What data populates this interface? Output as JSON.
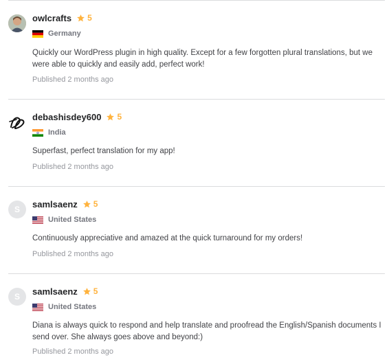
{
  "colors": {
    "star": "#ffb33e",
    "divider": "#dadbdd",
    "meta": "#95979d"
  },
  "reviews": [
    {
      "username": "owlcrafts",
      "rating": "5",
      "country": "Germany",
      "flag_icon": "germany-flag-icon",
      "avatar": "user-photo",
      "description": "Quickly our WordPress plugin in high quality. Except for a few forgotten plural translations, but we were able to quickly and easily add, perfect work!",
      "published": "Published 2 months ago"
    },
    {
      "username": "debashisdey600",
      "rating": "5",
      "country": "India",
      "flag_icon": "india-flag-icon",
      "avatar": "dd-signature-logo",
      "description": "Superfast, perfect translation for my app!",
      "published": "Published 2 months ago"
    },
    {
      "username": "samlsaenz",
      "rating": "5",
      "country": "United States",
      "flag_icon": "us-flag-icon",
      "avatar_initial": "S",
      "description": "Continuously appreciative and amazed at the quick turnaround for my orders!",
      "published": "Published 2 months ago"
    },
    {
      "username": "samlsaenz",
      "rating": "5",
      "country": "United States",
      "flag_icon": "us-flag-icon",
      "avatar_initial": "S",
      "description": "Diana is always quick to respond and help translate and proofread the English/Spanish documents I send over. She always goes above and beyond:)",
      "published": "Published 2 months ago"
    }
  ]
}
